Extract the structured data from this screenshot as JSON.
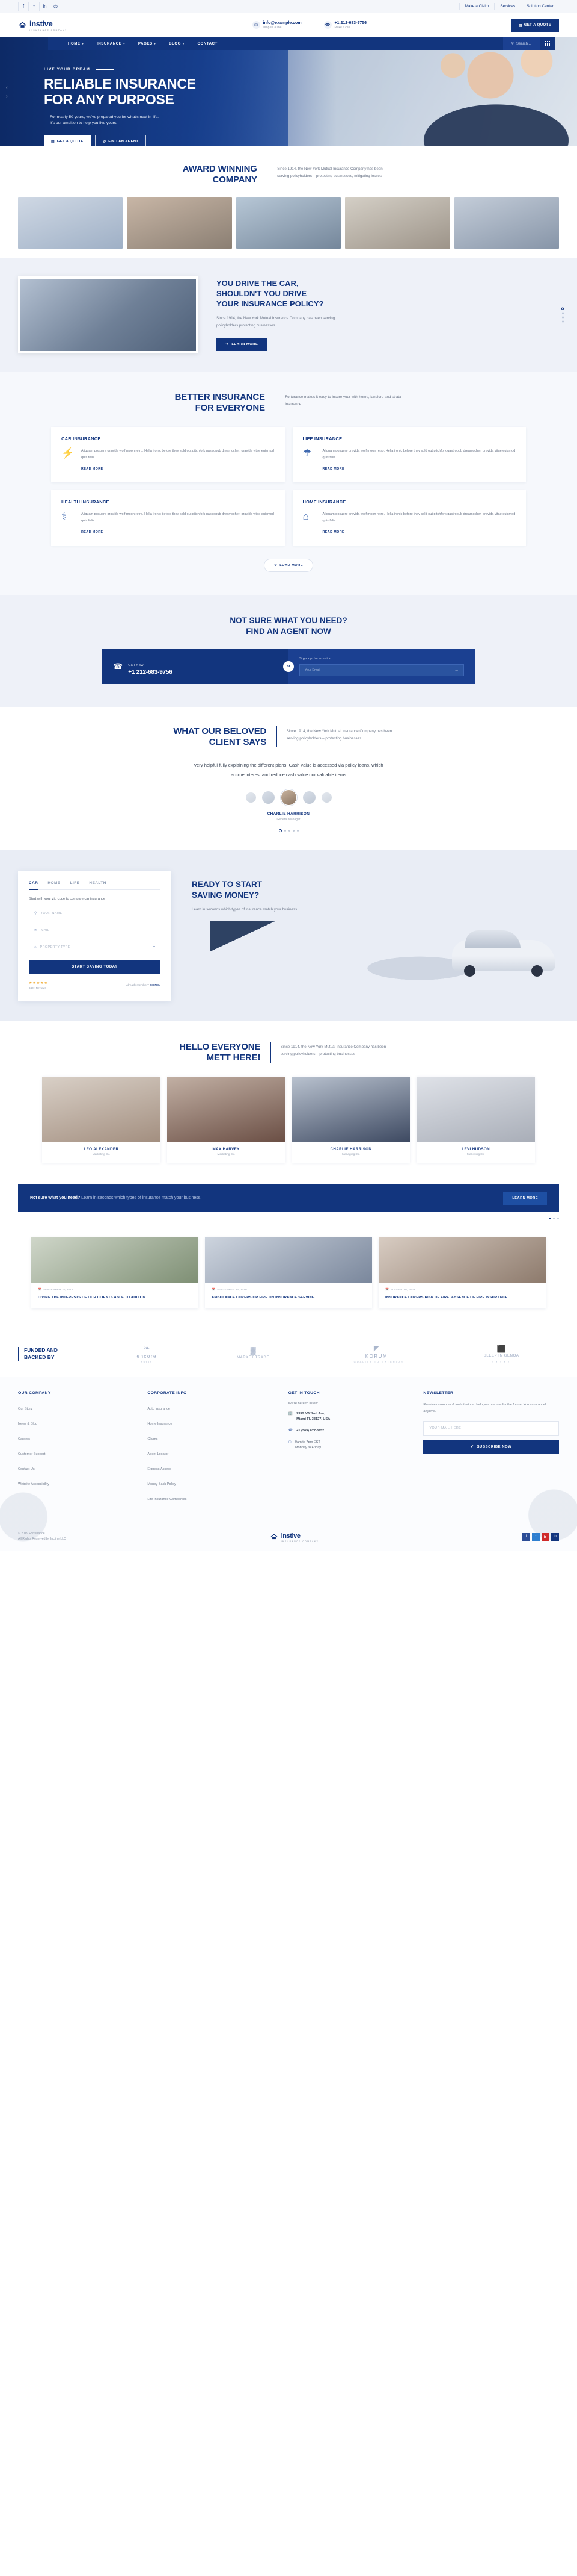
{
  "topbar": {
    "social": [
      {
        "name": "facebook-icon",
        "glyph": "f"
      },
      {
        "name": "twitter-icon",
        "glyph": "ᵛ"
      },
      {
        "name": "linkedin-icon",
        "glyph": "in"
      },
      {
        "name": "instagram-icon",
        "glyph": "◎"
      }
    ],
    "links": [
      "Make a Claim",
      "Services",
      "Solution Center"
    ]
  },
  "header": {
    "logo_name": "instive",
    "logo_sub": "INSURANCE COMPANY",
    "email": "info@example.com",
    "email_sub": "Drop us a line",
    "phone": "+1 212-683-9756",
    "phone_sub": "Make a call",
    "quote_button": "GET A QUOTE"
  },
  "nav": {
    "items": [
      {
        "label": "HOME",
        "caret": true
      },
      {
        "label": "INSURANCE",
        "caret": true
      },
      {
        "label": "PAGES",
        "caret": true
      },
      {
        "label": "BLOG",
        "caret": true
      },
      {
        "label": "CONTACT",
        "caret": false
      }
    ],
    "search_placeholder": "Search..."
  },
  "hero": {
    "kicker": "LIVE YOUR DREAM",
    "title_line1": "RELIABLE INSURANCE",
    "title_line2": "FOR ANY PURPOSE",
    "desc": "For nearly 50 years, we've prepared you for what's next in life. It's our ambition to help you live yours.",
    "btn_primary": "GET A QUOTE",
    "btn_secondary": "FIND AN AGENT"
  },
  "award": {
    "title_line1": "AWARD WINNING",
    "title_line2": "COMPANY",
    "note": "Since 1914, the New York Mutual Insurance Company has been serving policyholders – protecting businesses, mitigating losses"
  },
  "drive": {
    "title_line1": "YOU DRIVE THE CAR,",
    "title_line2": "SHOULDN'T YOU DRIVE",
    "title_line3": "YOUR INSURANCE POLICY?",
    "desc": "Since 1914, the New York Mutual Insurance Company has been serving policyholders protecting businesses",
    "button": "LEARN MORE"
  },
  "better": {
    "title_line1": "BETTER INSURANCE",
    "title_line2": "FOR EVERYONE",
    "note": "Forturance makes it easy to insure your with home, landlord and strata insurance.",
    "cards": [
      {
        "title": "CAR INSURANCE",
        "icon": "car-crash-icon",
        "glyph": "⚡",
        "text": "Aliquam posuere gravida wolf moon retro. Hella ironic before they sold out pitchfork gastropub dreamccher. gravida vitae euismod quis felis.",
        "more": "READ MORE"
      },
      {
        "title": "LIFE INSURANCE",
        "icon": "umbrella-family-icon",
        "glyph": "☂",
        "text": "Aliquam posuere gravida wolf moon retro. Hella ironic before they sold out pitchfork gastropub dreamccher. gravida vitae euismod quis felis.",
        "more": "READ MORE"
      },
      {
        "title": "HEALTH INSURANCE",
        "icon": "heartbeat-icon",
        "glyph": "⚕",
        "text": "Aliquam posuere gravida wolf moon retro. Hella ironic before they sold out pitchfork gastropub dreamccher. gravida vitae euismod quis felis.",
        "more": "READ MORE"
      },
      {
        "title": "HOME INSURANCE",
        "icon": "house-shield-icon",
        "glyph": "⌂",
        "text": "Aliquam posuere gravida wolf moon retro. Hella ironic before they sold out pitchfork gastropub dreamccher. gravida vitae euismod quis felis.",
        "more": "READ MORE"
      }
    ],
    "load_more": "LOAD MORE"
  },
  "agent": {
    "title_line1": "NOT SURE WHAT YOU NEED?",
    "title_line2": "FIND AN AGENT NOW",
    "call_label": "Call Now",
    "call_number": "+1 212-683-9756",
    "or": "or",
    "mail_label": "Sign up for emails",
    "mail_placeholder": "Your Email"
  },
  "testimonial": {
    "title_line1": "WHAT OUR BELOVED",
    "title_line2": "CLIENT SAYS",
    "note": "Since 1914, the New York Mutual Insurance Company has been serving policyholders – protecting businesses.",
    "quote": "Very helpful fully explaining the different plans. Cash value is accessed via policy loans, which accrue interest and reduce cash value our valuable items",
    "name": "CHARLIE HARRISON",
    "role": "General Manager",
    "dots": 5,
    "active_dot": 0
  },
  "saving": {
    "tabs": [
      "CAR",
      "HOME",
      "LIFE",
      "HEALTH"
    ],
    "active_tab": "CAR",
    "subtitle": "Start with your zip code to compare car insurance",
    "fields": [
      {
        "name": "name-field",
        "icon": "user-icon",
        "glyph": "⚲",
        "placeholder": "YOUR NAME"
      },
      {
        "name": "email-field",
        "icon": "mail-icon",
        "glyph": "✉",
        "placeholder": "MAIL"
      },
      {
        "name": "property-select",
        "icon": "home-icon",
        "glyph": "⌂",
        "placeholder": "PROPERTY TYPE"
      }
    ],
    "submit": "START SAVING TODAY",
    "rating_stars": "★★★★★",
    "rating_label": "940+ Reviews",
    "member_label": "Already member?",
    "member_link": "SIGN IN",
    "title_line1": "READY TO START",
    "title_line2": "SAVING MONEY?",
    "desc": "Learn in seconds which types of insurance match your business."
  },
  "team": {
    "title_line1": "HELLO EVERYONE",
    "title_line2": "METT HERE!",
    "note": "Since 1914, the New York Mutual Insurance Company has been serving policyholders – protecting businesses",
    "members": [
      {
        "name": "LEO ALEXANDER",
        "role": "Marketing Ex."
      },
      {
        "name": "MAX HARVEY",
        "role": "Marketing Ex."
      },
      {
        "name": "CHARLIE HARRISON",
        "role": "Managing Dir."
      },
      {
        "name": "LEVI HUDSON",
        "role": "Marketing Ex."
      }
    ]
  },
  "notsure": {
    "bold": "Not sure what you need?",
    "rest": " Learn in seconds which types of insurance match your business.",
    "button": "LEARN MORE"
  },
  "blog": {
    "posts": [
      {
        "date": "SEPTEMBER 20, 2019",
        "title": "DIVING THE INTERESTS OF OUR CLIENTS ABLE TO ADD ON"
      },
      {
        "date": "SEPTEMBER 20, 2019",
        "title": "AMBULANCE COVERS OR FIRE ON INSURANCE SERVING"
      },
      {
        "date": "AUGUST 10, 2019",
        "title": "INSURANCE COVERS RISK OF FIRE. ABSENCE OF FIRE INSURANCE"
      }
    ]
  },
  "funded": {
    "label_line1": "FUNDED AND",
    "label_line2": "BACKED BY",
    "brands": [
      {
        "name": "encore",
        "sub": "autos",
        "glyph": "❧"
      },
      {
        "name": "MARKET TRADE",
        "sub": "",
        "glyph": "▓"
      },
      {
        "name": "KORUM",
        "sub": "T GUALITY TO EXTERIOR",
        "glyph": "◤"
      },
      {
        "name": "SLEEP IN GENOA",
        "sub": "▪ ▪ ▪ ▪ ▪",
        "glyph": "⬛"
      }
    ]
  },
  "footer": {
    "columns": [
      {
        "heading": "OUR COMPANY",
        "links": [
          "Our Story",
          "News & Blog",
          "Careers",
          "Customer Support",
          "Contact Us",
          "Website Accessibility"
        ]
      },
      {
        "heading": "CORPORATE INFO",
        "links": [
          "Auto Insurance",
          "Home Insurance",
          "Claims",
          "Agent Locator",
          "Express Access",
          "Money Back Policy",
          "Life Insurance Companies"
        ]
      }
    ],
    "touch": {
      "heading": "GET IN TOUCH",
      "intro": "We're here to listen:",
      "address_line1": "2390 NW 2nd Ave,",
      "address_line2": "Miami FL 33127, USA",
      "phone": "+1 (305) 677-3952",
      "hours_line1": "9am to 7pm EST",
      "hours_line2": "Monday to Friday"
    },
    "newsletter": {
      "heading": "NEWSLETTER",
      "text": "Receive resources & tools that can help you prepare for the future. You can cancel anytime.",
      "placeholder": "YOUR MAIL HERE",
      "button": "SUBSCRIBE NOW"
    },
    "copyright_line1": "© 2019 Fortunance.",
    "copyright_line2": "All Rights Reserved by Incline LLC",
    "logo_name": "instive",
    "logo_sub": "INSURANCE COMPANY",
    "social": [
      {
        "name": "facebook-icon",
        "glyph": "f",
        "cls": "fs-fb"
      },
      {
        "name": "twitter-icon",
        "glyph": "ᵛ",
        "cls": "fs-tw"
      },
      {
        "name": "youtube-icon",
        "glyph": "▶",
        "cls": "fs-yt"
      },
      {
        "name": "linkedin-icon",
        "glyph": "in",
        "cls": "fs-in"
      }
    ]
  }
}
